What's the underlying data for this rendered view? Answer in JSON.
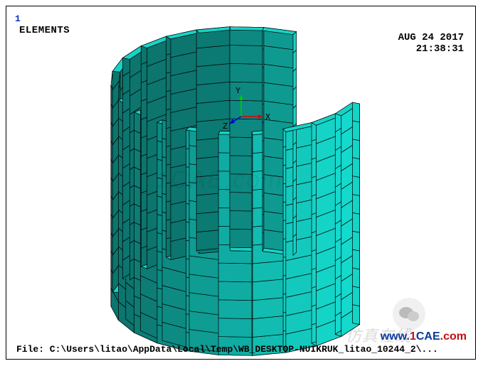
{
  "plot_number": "1",
  "header_label": "ELEMENTS",
  "date": "AUG 24 2017",
  "time": "21:38:31",
  "triad": {
    "x_label": "X",
    "y_label": "Y",
    "z_label": "Z"
  },
  "file_line": "File: C:\\Users\\litao\\AppData\\Local\\Temp\\WB_DESKTOP-NUIKRUK_litao_10244_2\\...",
  "watermark_center": "1CAE.com",
  "watermark_text_cn": "仿真在线",
  "watermark_url": {
    "www": "www.",
    "one": "1",
    "cae": "CAE",
    "com": ".com"
  },
  "mesh": {
    "color_fill": "#14d4c8",
    "color_edge": "#000000",
    "shell_divisions_circumferential": 18,
    "shell_divisions_vertical": 12,
    "thickness_divisions": 1,
    "open_angle_deg": 270
  }
}
